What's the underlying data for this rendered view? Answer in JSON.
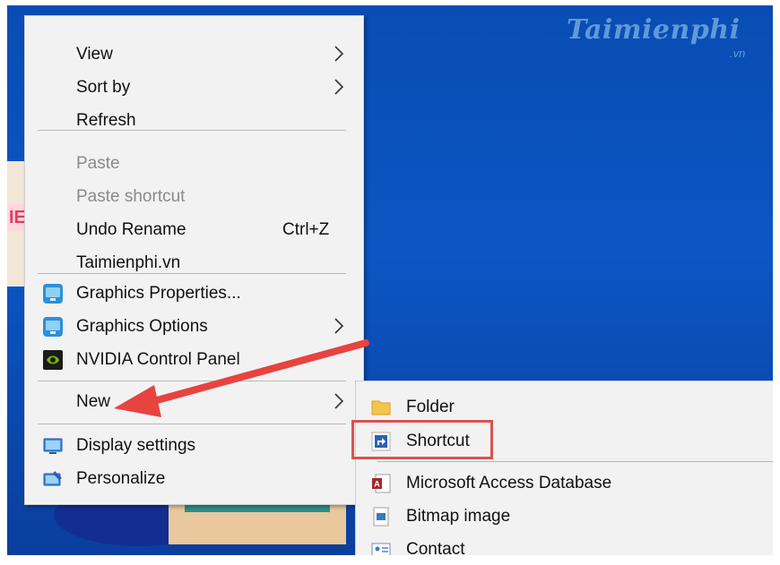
{
  "logo": {
    "text": "Taimienphi",
    "suffix": ".vn"
  },
  "background": {
    "card_text": "IE"
  },
  "context_menu": {
    "items": [
      {
        "label": "View",
        "submenu": true,
        "disabled": false,
        "icon": ""
      },
      {
        "label": "Sort by",
        "submenu": true,
        "disabled": false,
        "icon": ""
      },
      {
        "label": "Refresh",
        "submenu": false,
        "disabled": false,
        "icon": ""
      },
      {
        "label": "Paste",
        "submenu": false,
        "disabled": true,
        "icon": ""
      },
      {
        "label": "Paste shortcut",
        "submenu": false,
        "disabled": true,
        "icon": ""
      },
      {
        "label": "Undo Rename",
        "shortcut": "Ctrl+Z",
        "submenu": false,
        "disabled": false,
        "icon": ""
      },
      {
        "label": "Taimienphi.vn",
        "submenu": false,
        "disabled": false,
        "icon": ""
      },
      {
        "label": "Graphics Properties...",
        "submenu": false,
        "disabled": false,
        "icon": "intel-graphics-icon"
      },
      {
        "label": "Graphics Options",
        "submenu": true,
        "disabled": false,
        "icon": "intel-graphics-icon"
      },
      {
        "label": "NVIDIA Control Panel",
        "submenu": false,
        "disabled": false,
        "icon": "nvidia-icon"
      },
      {
        "label": "New",
        "submenu": true,
        "disabled": false,
        "icon": ""
      },
      {
        "label": "Display settings",
        "submenu": false,
        "disabled": false,
        "icon": "display-icon"
      },
      {
        "label": "Personalize",
        "submenu": false,
        "disabled": false,
        "icon": "personalize-icon"
      }
    ]
  },
  "new_submenu": {
    "items": [
      {
        "label": "Folder",
        "icon": "folder-icon"
      },
      {
        "label": "Shortcut",
        "icon": "shortcut-icon",
        "highlighted": true
      },
      {
        "label": "Microsoft Access Database",
        "icon": "access-icon"
      },
      {
        "label": "Bitmap image",
        "icon": "bitmap-icon"
      },
      {
        "label": "Contact",
        "icon": "contact-icon"
      }
    ]
  },
  "colors": {
    "desktop": "#0b56c4",
    "menu_bg": "#f2f2f2",
    "annotation_red": "#e8433f",
    "logo": "#5f9ad8"
  }
}
